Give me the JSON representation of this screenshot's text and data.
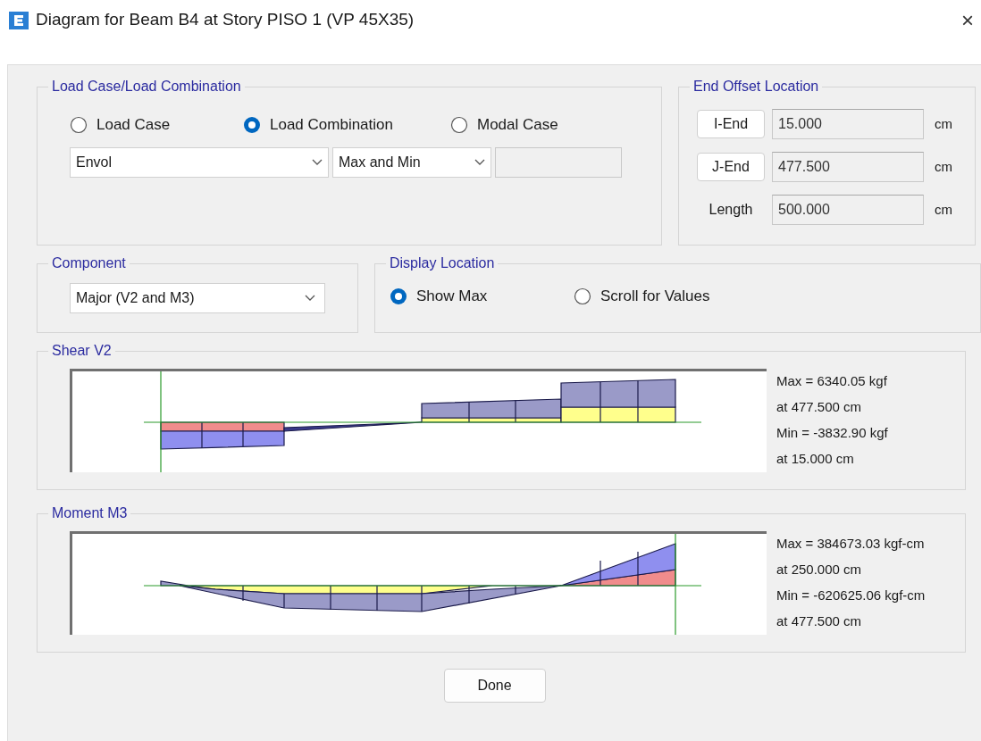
{
  "window": {
    "title": "Diagram for Beam B4 at Story PISO 1 (VP 45X35)",
    "close": "×"
  },
  "load_case_group": {
    "title": "Load Case/Load Combination",
    "options": [
      {
        "label": "Load Case",
        "selected": false
      },
      {
        "label": "Load Combination",
        "selected": true
      },
      {
        "label": "Modal Case",
        "selected": false
      }
    ],
    "case_dropdown": "Envol",
    "type_dropdown": "Max and Min"
  },
  "end_offset": {
    "title": "End Offset Location",
    "rows": [
      {
        "kind": "button",
        "label": "I-End",
        "value": "15.000",
        "unit": "cm"
      },
      {
        "kind": "button",
        "label": "J-End",
        "value": "477.500",
        "unit": "cm"
      },
      {
        "kind": "label",
        "label": "Length",
        "value": "500.000",
        "unit": "cm"
      }
    ]
  },
  "component": {
    "title": "Component",
    "value": "Major (V2 and M3)"
  },
  "display_location": {
    "title": "Display Location",
    "options": [
      {
        "label": "Show Max",
        "selected": true
      },
      {
        "label": "Scroll for Values",
        "selected": false
      }
    ]
  },
  "diagrams": [
    {
      "title": "Shear V2",
      "kind": "shear",
      "readout": [
        "Max = 6340.05 kgf",
        "at 477.500 cm",
        "Min = -3832.90 kgf",
        "at 15.000 cm"
      ]
    },
    {
      "title": "Moment M3",
      "kind": "moment",
      "readout": [
        "Max = 384673.03 kgf-cm",
        "at 250.000 cm",
        "Min = -620625.06 kgf-cm",
        "at 477.500 cm"
      ]
    }
  ],
  "buttons": [
    {
      "label": "Done"
    }
  ]
}
